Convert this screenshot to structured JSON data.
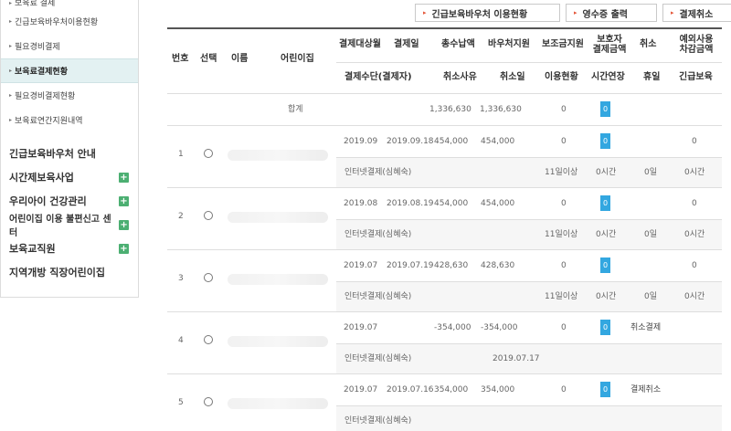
{
  "sidebar": {
    "sub_items": [
      {
        "label": "보육료 결제"
      },
      {
        "label": "긴급보육바우처이용현황"
      },
      {
        "label": "필요경비결제"
      },
      {
        "label": "보육료결제현황"
      },
      {
        "label": "필요경비결제현황"
      },
      {
        "label": "보육료연간지원내역"
      }
    ],
    "main_items": [
      {
        "label": "긴급보육바우처 안내",
        "has_plus": false
      },
      {
        "label": "시간제보육사업",
        "has_plus": true
      },
      {
        "label": "우리아이 건강관리",
        "has_plus": true
      },
      {
        "label": "어린이집 이용 불편신고 센터",
        "has_plus": true
      },
      {
        "label": "보육교직원",
        "has_plus": true
      },
      {
        "label": "지역개방 직장어린이집",
        "has_plus": false
      }
    ],
    "plus_symbol": "+",
    "arrow_symbol": "▸",
    "active_index": 3
  },
  "buttons": {
    "voucher": "긴급보육바우처 이용현황",
    "receipt": "영수증 출력",
    "cancel": "결제취소",
    "arrow": "▸"
  },
  "table": {
    "headers": {
      "no": "번호",
      "select": "선택",
      "name": "이름",
      "center": "어린이집",
      "target_month": "결제대상월",
      "pay_date": "결제일",
      "total": "총수납액",
      "voucher": "바우처지원",
      "subsidy": "보조금지원",
      "guardian_line1": "보호자",
      "guardian_line2": "결제금액",
      "cancel": "취소",
      "extra_line1": "예외사용",
      "extra_line2": "차감금액",
      "method": "결제수단(결제자)",
      "reason": "취소사유",
      "cancel_date": "취소일",
      "usage": "이용현황",
      "time_ext": "시간연장",
      "holiday": "휴일",
      "emergency": "긴급보육"
    },
    "total_row": {
      "label": "합계",
      "total": "1,336,630",
      "voucher": "1,336,630",
      "subsidy": "0",
      "guardian": "0"
    },
    "rows": [
      {
        "no": "1",
        "month": "2019.09",
        "date": "2019.09.18",
        "total": "454,000",
        "voucher": "454,000",
        "subsidy": "0",
        "guardian": "0",
        "cancel": "",
        "extra": "0",
        "method": "인터넷결제(심혜숙)",
        "reason": "",
        "cancel_date": "",
        "usage": "11일이상",
        "time_ext": "0시간",
        "holiday": "0일",
        "emergency": "0시간"
      },
      {
        "no": "2",
        "month": "2019.08",
        "date": "2019.08.19",
        "total": "454,000",
        "voucher": "454,000",
        "subsidy": "0",
        "guardian": "0",
        "cancel": "",
        "extra": "0",
        "method": "인터넷결제(심혜숙)",
        "reason": "",
        "cancel_date": "",
        "usage": "11일이상",
        "time_ext": "0시간",
        "holiday": "0일",
        "emergency": "0시간"
      },
      {
        "no": "3",
        "month": "2019.07",
        "date": "2019.07.19",
        "total": "428,630",
        "voucher": "428,630",
        "subsidy": "0",
        "guardian": "0",
        "cancel": "",
        "extra": "0",
        "method": "인터넷결제(심혜숙)",
        "reason": "",
        "cancel_date": "",
        "usage": "11일이상",
        "time_ext": "0시간",
        "holiday": "0일",
        "emergency": "0시간"
      },
      {
        "no": "4",
        "month": "2019.07",
        "date": "",
        "total": "-354,000",
        "voucher": "-354,000",
        "subsidy": "0",
        "guardian": "0",
        "cancel": "취소결제",
        "extra": "",
        "method": "인터넷결제(심혜숙)",
        "reason": "",
        "cancel_date": "2019.07.17",
        "usage": "",
        "time_ext": "",
        "holiday": "",
        "emergency": ""
      },
      {
        "no": "5",
        "month": "2019.07",
        "date": "2019.07.16",
        "total": "354,000",
        "voucher": "354,000",
        "subsidy": "0",
        "guardian": "0",
        "cancel": "결제취소",
        "extra": "",
        "method": "인터넷결제(심혜숙)",
        "reason": "",
        "cancel_date": "",
        "usage": "",
        "time_ext": "",
        "holiday": "",
        "emergency": ""
      }
    ]
  },
  "colors": {
    "badge": "#33a7e0",
    "active_bg": "#e3f1f2",
    "plus": "#4caf72",
    "button_arrow": "#e4573a",
    "alt_row": "#f6f6f6"
  }
}
